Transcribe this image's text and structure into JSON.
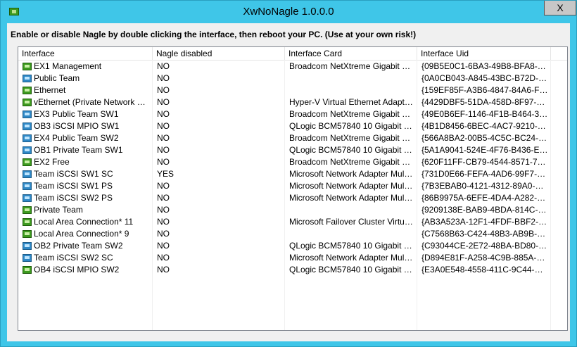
{
  "window": {
    "title": "XwNoNagle 1.0.0.0",
    "close_label": "X"
  },
  "instructions": "Enable or disable Nagle by double clicking the interface, then reboot your PC. (Use at your own risk!)",
  "columns": [
    "Interface",
    "Nagle disabled",
    "Interface Card",
    "Interface Uid"
  ],
  "rows": [
    {
      "icon": "network-adapter-icon",
      "icon_color": "green",
      "name": "EX1 Management",
      "nagle": "NO",
      "card": "Broadcom NetXtreme Gigabit Ether...",
      "uid": "{09B5E0C1-6BA3-49B8-BFA8-0E9..."
    },
    {
      "icon": "network-adapter-icon",
      "icon_color": "blue",
      "name": "Public Team",
      "nagle": "NO",
      "card": "",
      "uid": "{0A0CB043-A845-43BC-B72D-51A..."
    },
    {
      "icon": "network-adapter-icon",
      "icon_color": "green",
      "name": "Ethernet",
      "nagle": "NO",
      "card": "",
      "uid": "{159EF85F-A3B6-4847-84A6-FF6D..."
    },
    {
      "icon": "network-adapter-icon",
      "icon_color": "green",
      "name": "vEthernet (Private Network Virtu...",
      "nagle": "NO",
      "card": "Hyper-V Virtual Ethernet Adapter #2",
      "uid": "{4429DBF5-51DA-458D-8F97-38D..."
    },
    {
      "icon": "network-adapter-icon",
      "icon_color": "blue",
      "name": "EX3 Public Team SW1",
      "nagle": "NO",
      "card": "Broadcom NetXtreme Gigabit Ether...",
      "uid": "{49E0B6EF-1146-4F1B-B464-3D87..."
    },
    {
      "icon": "network-adapter-icon",
      "icon_color": "blue",
      "name": "OB3 iSCSI MPIO SW1",
      "nagle": "NO",
      "card": "QLogic BCM57840 10 Gigabit Ethe...",
      "uid": "{4B1D8456-6BEC-4AC7-9210-DB5..."
    },
    {
      "icon": "network-adapter-icon",
      "icon_color": "blue",
      "name": "EX4 Public Team SW2",
      "nagle": "NO",
      "card": "Broadcom NetXtreme Gigabit Ether...",
      "uid": "{566A8BA2-00B5-4C5C-BC24-A3B..."
    },
    {
      "icon": "network-adapter-icon",
      "icon_color": "blue",
      "name": "OB1 Private Team SW1",
      "nagle": "NO",
      "card": "QLogic BCM57840 10 Gigabit Ethe...",
      "uid": "{5A1A9041-524E-4F76-B436-E507..."
    },
    {
      "icon": "network-adapter-icon",
      "icon_color": "green",
      "name": "EX2 Free",
      "nagle": "NO",
      "card": "Broadcom NetXtreme Gigabit Ether...",
      "uid": "{620F11FF-CB79-4544-8571-7941..."
    },
    {
      "icon": "network-adapter-icon",
      "icon_color": "blue",
      "name": "Team iSCSI SW1 SC",
      "nagle": "YES",
      "card": "Microsoft Network Adapter Multiple...",
      "uid": "{731D0E66-FEFA-4AD6-99F7-C1D..."
    },
    {
      "icon": "network-adapter-icon",
      "icon_color": "blue",
      "name": "Team iSCSI SW1 PS",
      "nagle": "NO",
      "card": "Microsoft Network Adapter Multiple...",
      "uid": "{7B3EBAB0-4121-4312-89A0-13F1..."
    },
    {
      "icon": "network-adapter-icon",
      "icon_color": "blue",
      "name": "Team iSCSI SW2 PS",
      "nagle": "NO",
      "card": "Microsoft Network Adapter Multiple...",
      "uid": "{86B9975A-6EFE-4DA4-A282-E99..."
    },
    {
      "icon": "network-adapter-icon",
      "icon_color": "green",
      "name": "Private Team",
      "nagle": "NO",
      "card": "",
      "uid": "{9209138E-BAB9-4BDA-814C-762..."
    },
    {
      "icon": "network-adapter-icon",
      "icon_color": "green",
      "name": "Local Area Connection* 11",
      "nagle": "NO",
      "card": "Microsoft Failover Cluster Virtual Ad...",
      "uid": "{AB3A523A-12F1-4FDF-BBF2-477..."
    },
    {
      "icon": "network-adapter-icon",
      "icon_color": "green",
      "name": "Local Area Connection* 9",
      "nagle": "NO",
      "card": "",
      "uid": "{C7568B63-C424-48B3-AB9B-6D1..."
    },
    {
      "icon": "network-adapter-icon",
      "icon_color": "blue",
      "name": "OB2 Private Team SW2",
      "nagle": "NO",
      "card": "QLogic BCM57840 10 Gigabit Ethe...",
      "uid": "{C93044CE-2E72-48BA-BD80-CFF..."
    },
    {
      "icon": "network-adapter-icon",
      "icon_color": "blue",
      "name": "Team iSCSI SW2 SC",
      "nagle": "NO",
      "card": "Microsoft Network Adapter Multiple...",
      "uid": "{D894E81F-A258-4C9B-885A-1305..."
    },
    {
      "icon": "network-adapter-icon",
      "icon_color": "green",
      "name": "OB4 iSCSI MPIO SW2",
      "nagle": "NO",
      "card": "QLogic BCM57840 10 Gigabit Ethe...",
      "uid": "{E3A0E548-4558-411C-9C44-C249..."
    }
  ],
  "colors": {
    "title_bar": "#3fc6e8",
    "client_bg": "#f0f0f0",
    "icon_green": "#3d9a1f",
    "icon_blue": "#2f88c6"
  }
}
